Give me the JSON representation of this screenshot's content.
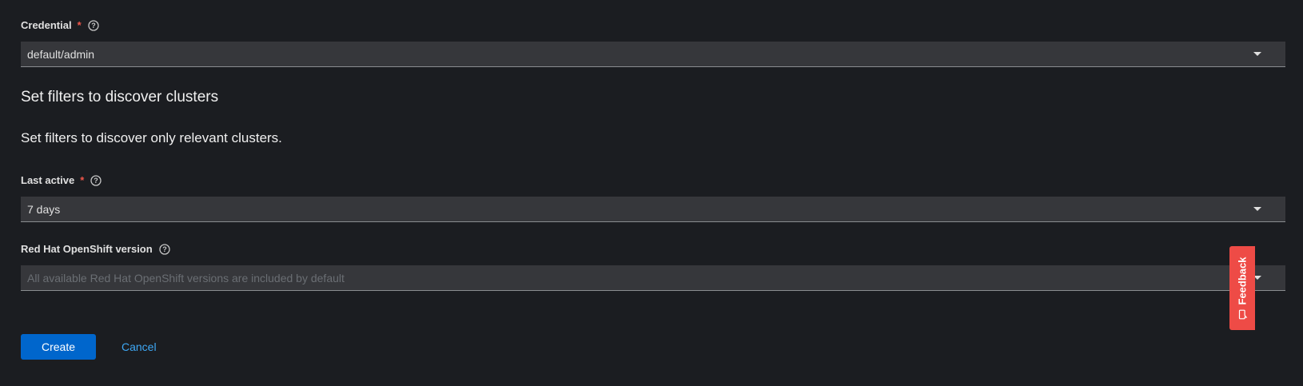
{
  "credential": {
    "label": "Credential",
    "required_mark": "*",
    "value": "default/admin"
  },
  "filters_section": {
    "title": "Set filters to discover clusters",
    "description": "Set filters to discover only relevant clusters."
  },
  "last_active": {
    "label": "Last active",
    "required_mark": "*",
    "value": "7 days"
  },
  "openshift_version": {
    "label": "Red Hat OpenShift version",
    "placeholder": "All available Red Hat OpenShift versions are included by default"
  },
  "actions": {
    "create_label": "Create",
    "cancel_label": "Cancel"
  },
  "feedback": {
    "label": "Feedback"
  },
  "colors": {
    "background": "#1b1d21",
    "primary": "#0066cc",
    "link": "#3ea8f5",
    "required": "#f0564a",
    "feedback": "#ee4b46"
  }
}
